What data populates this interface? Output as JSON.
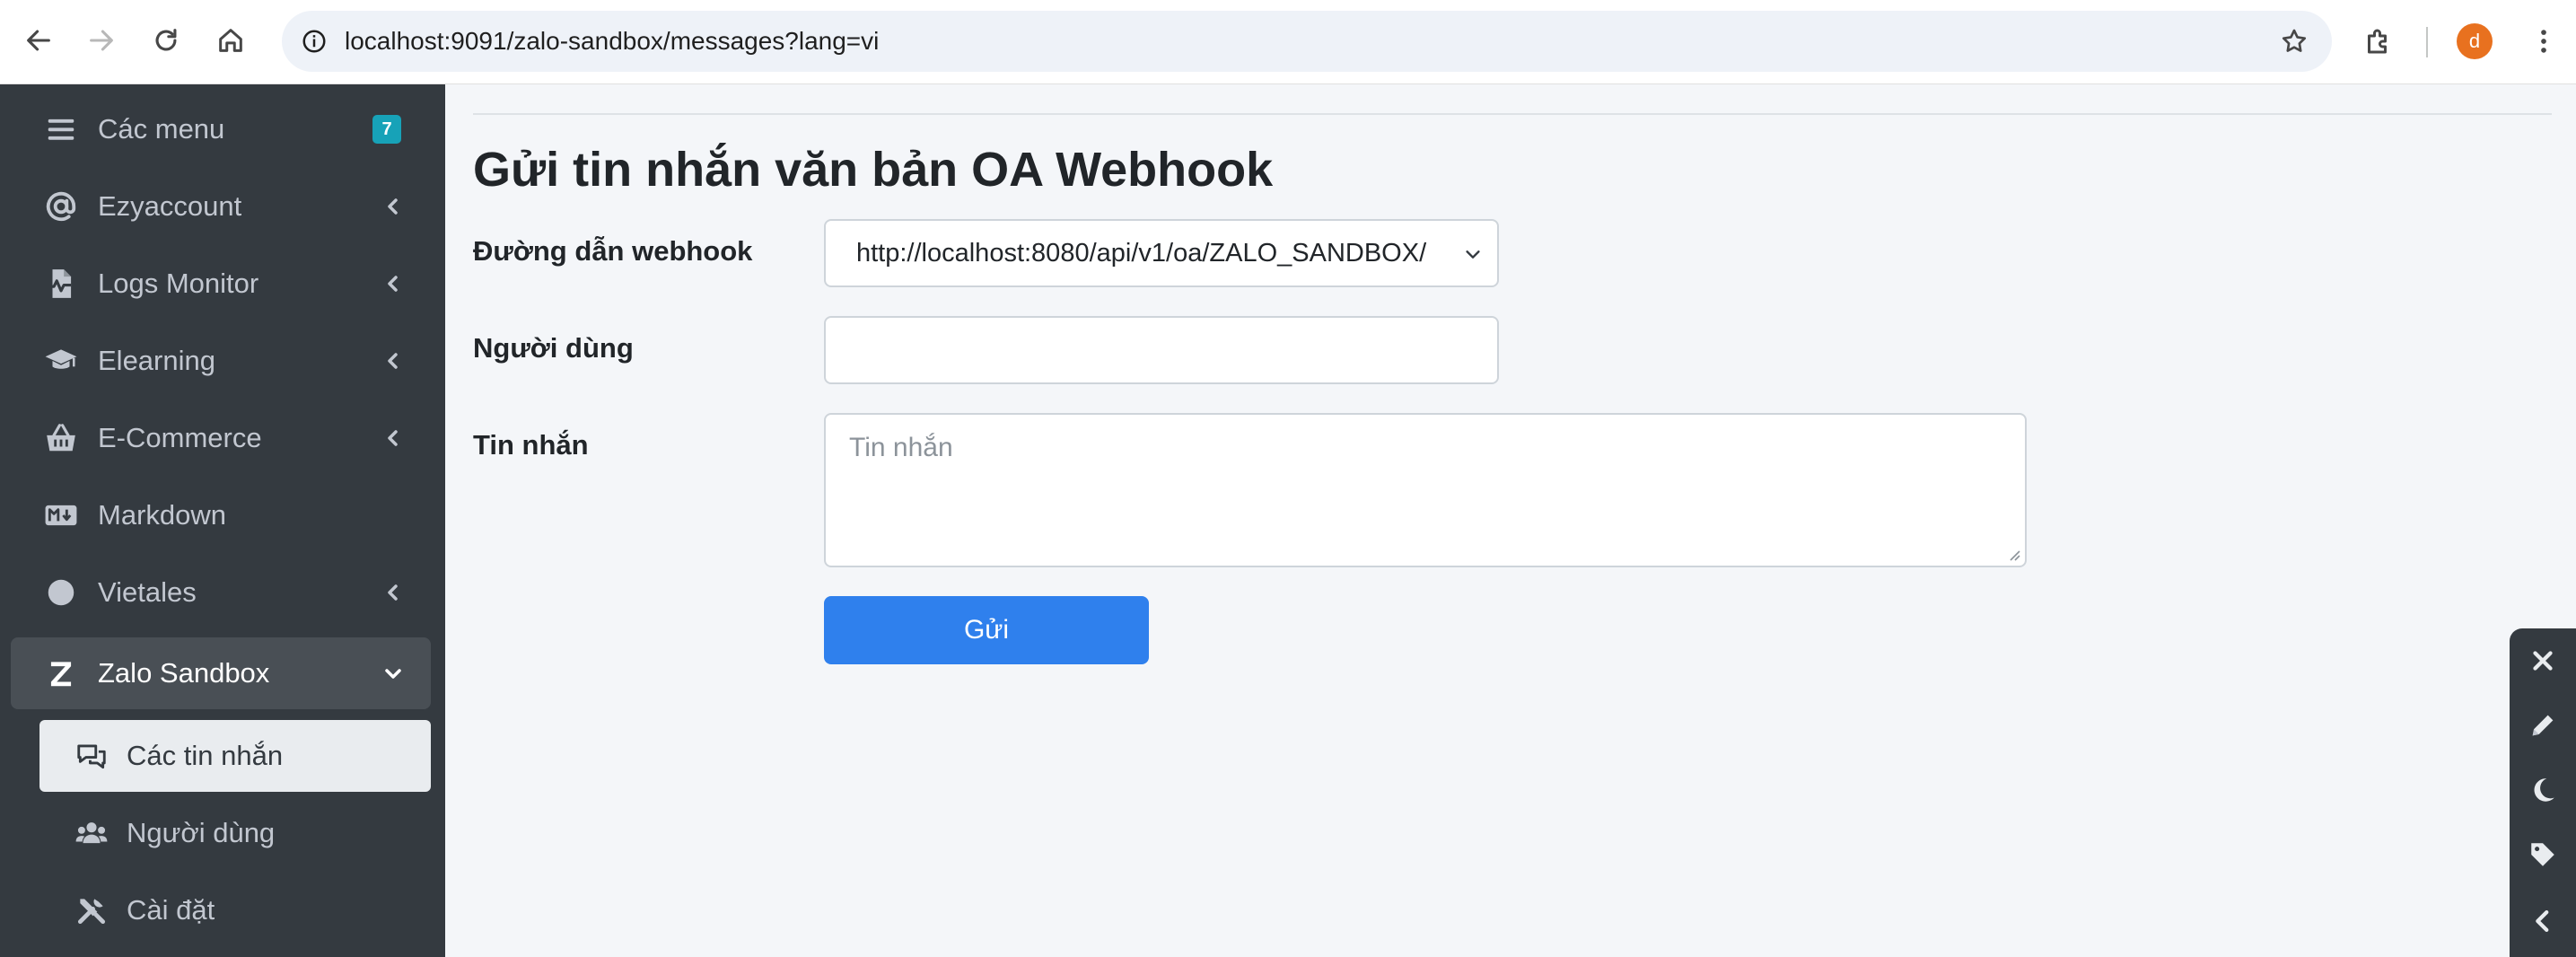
{
  "browser": {
    "url": "localhost:9091/zalo-sandbox/messages?lang=vi",
    "profile_initial": "d"
  },
  "sidebar": {
    "items": [
      {
        "label": "Các menu",
        "icon": "hamburger-icon",
        "badge": "7"
      },
      {
        "label": "Ezyaccount",
        "icon": "at-icon",
        "expandable": true
      },
      {
        "label": "Logs Monitor",
        "icon": "file-pulse-icon",
        "expandable": true
      },
      {
        "label": "Elearning",
        "icon": "graduation-cap-icon",
        "expandable": true
      },
      {
        "label": "E-Commerce",
        "icon": "basket-icon",
        "expandable": true
      },
      {
        "label": "Markdown",
        "icon": "markdown-icon"
      },
      {
        "label": "Vietales",
        "icon": "circle-icon",
        "expandable": true
      },
      {
        "label": "Zalo Sandbox",
        "icon": "zalo-z-icon",
        "expanded": true
      }
    ],
    "subitems": [
      {
        "label": "Các tin nhắn",
        "icon": "chat-bubbles-icon",
        "active": true
      },
      {
        "label": "Người dùng",
        "icon": "users-icon"
      },
      {
        "label": "Cài đặt",
        "icon": "tools-icon"
      }
    ]
  },
  "main": {
    "title": "Gửi tin nhắn văn bản OA Webhook",
    "form": {
      "webhook_label": "Đường dẫn webhook",
      "webhook_value": "http://localhost:8080/api/v1/oa/ZALO_SANDBOX/",
      "user_label": "Người dùng",
      "user_value": "",
      "message_label": "Tin nhắn",
      "message_placeholder": "Tin nhắn",
      "submit_label": "Gửi"
    }
  },
  "floating_toolbar": {
    "buttons": [
      "close-icon",
      "pencil-icon",
      "moon-icon",
      "tag-icon",
      "chevron-left-icon"
    ]
  },
  "colors": {
    "sidebar_bg": "#343a40",
    "content_bg": "#f4f6f9",
    "primary_button": "#2f80ed",
    "badge": "#17a2b8",
    "profile": "#e8711f"
  }
}
